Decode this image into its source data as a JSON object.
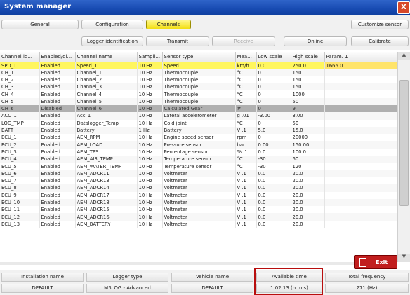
{
  "window": {
    "title": "System manager",
    "close_glyph": "X"
  },
  "toolbar": {
    "row1": [
      "General",
      "Configuration",
      "Channels",
      "Customize sensor"
    ],
    "row2": [
      "Logger identification",
      "Transmit",
      "Receive",
      "Online",
      "Calibrate"
    ]
  },
  "columns": [
    "Channel id...",
    "Enabled/di...",
    "Channel name",
    "Sampli...",
    "Sensor type",
    "Mea...",
    "Low scale",
    "High scale",
    "Param. 1"
  ],
  "rows": [
    [
      "SPD_1",
      "Enabled",
      "Speed_1",
      "10 Hz",
      "Speed",
      "km/h...",
      "0.0",
      "250.0",
      "1666.0"
    ],
    [
      "CH_1",
      "Enabled",
      "Channel_1",
      "10 Hz",
      "Thermocouple",
      "°C",
      "0",
      "150",
      ""
    ],
    [
      "CH_2",
      "Enabled",
      "Channel_2",
      "10 Hz",
      "Thermocouple",
      "°C",
      "0",
      "150",
      ""
    ],
    [
      "CH_3",
      "Enabled",
      "Channel_3",
      "10 Hz",
      "Thermocouple",
      "°C",
      "0",
      "150",
      ""
    ],
    [
      "CH_4",
      "Enabled",
      "Channel_4",
      "10 Hz",
      "Thermocouple",
      "°C",
      "0",
      "1000",
      ""
    ],
    [
      "CH_5",
      "Enabled",
      "Channel_5",
      "10 Hz",
      "Thermocouple",
      "°C",
      "0",
      "50",
      ""
    ],
    [
      "CH_6",
      "Disabled",
      "Channel_6",
      "10 Hz",
      "Calculated Gear",
      "#",
      "0",
      "9",
      ""
    ],
    [
      "ACC_1",
      "Enabled",
      "Acc_1",
      "10 Hz",
      "Lateral accelerometer",
      "g .01",
      "-3.00",
      "3.00",
      ""
    ],
    [
      "LOG_TMP",
      "Enabled",
      "Datalogger_Temp",
      "10 Hz",
      "Cold joint",
      "°C",
      "0",
      "50",
      ""
    ],
    [
      "BATT",
      "Enabled",
      "Battery",
      "1 Hz",
      "Battery",
      "V .1",
      "5.0",
      "15.0",
      ""
    ],
    [
      "ECU_1",
      "Enabled",
      "AEM_RPM",
      "10 Hz",
      "Engine speed sensor",
      "rpm",
      "0",
      "20000",
      ""
    ],
    [
      "ECU_2",
      "Enabled",
      "AEM_LOAD",
      "10 Hz",
      "Pressure sensor",
      "bar ...",
      "0.00",
      "150.00",
      ""
    ],
    [
      "ECU_3",
      "Enabled",
      "AEM_TPS",
      "10 Hz",
      "Percentage sensor",
      "% .1",
      "0.0",
      "100.0",
      ""
    ],
    [
      "ECU_4",
      "Enabled",
      "AEM_AIR_TEMP",
      "10 Hz",
      "Temperature sensor",
      "°C",
      "-30",
      "60",
      ""
    ],
    [
      "ECU_5",
      "Enabled",
      "AEM_WATER_TEMP",
      "10 Hz",
      "Temperature sensor",
      "°C",
      "-30",
      "120",
      ""
    ],
    [
      "ECU_6",
      "Enabled",
      "AEM_ADCR11",
      "10 Hz",
      "Voltmeter",
      "V .1",
      "0.0",
      "20.0",
      ""
    ],
    [
      "ECU_7",
      "Enabled",
      "AEM_ADCR13",
      "10 Hz",
      "Voltmeter",
      "V .1",
      "0.0",
      "20.0",
      ""
    ],
    [
      "ECU_8",
      "Enabled",
      "AEM_ADCR14",
      "10 Hz",
      "Voltmeter",
      "V .1",
      "0.0",
      "20.0",
      ""
    ],
    [
      "ECU_9",
      "Enabled",
      "AEM_ADCR17",
      "10 Hz",
      "Voltmeter",
      "V .1",
      "0.0",
      "20.0",
      ""
    ],
    [
      "ECU_10",
      "Enabled",
      "AEM_ADCR18",
      "10 Hz",
      "Voltmeter",
      "V .1",
      "0.0",
      "20.0",
      ""
    ],
    [
      "ECU_11",
      "Enabled",
      "AEM_ADCR15",
      "10 Hz",
      "Voltmeter",
      "V .1",
      "0.0",
      "20.0",
      ""
    ],
    [
      "ECU_12",
      "Enabled",
      "AEM_ADCR16",
      "10 Hz",
      "Voltmeter",
      "V .1",
      "0.0",
      "20.0",
      ""
    ],
    [
      "ECU_13",
      "Enabled",
      "AEM_BATTERY",
      "10 Hz",
      "Voltmeter",
      "V .1",
      "0.0",
      "20.0",
      ""
    ]
  ],
  "selected_row": 0,
  "disabled_row": 6,
  "exit": {
    "label": "Exit"
  },
  "footer": {
    "headers": [
      "Installation name",
      "Logger type",
      "Vehicle name",
      "Available time",
      "Total frequency"
    ],
    "values": [
      "DEFAULT",
      "M3LOG - Advanced",
      "DEFAULT",
      "1.02.13 (h.m.s)",
      "271 (Hz)"
    ]
  },
  "colors": {
    "selected": "#fff65e",
    "disabled": "#b0b0b0",
    "highlight_border": "#b80e0e",
    "exit": "#c11e1e"
  }
}
